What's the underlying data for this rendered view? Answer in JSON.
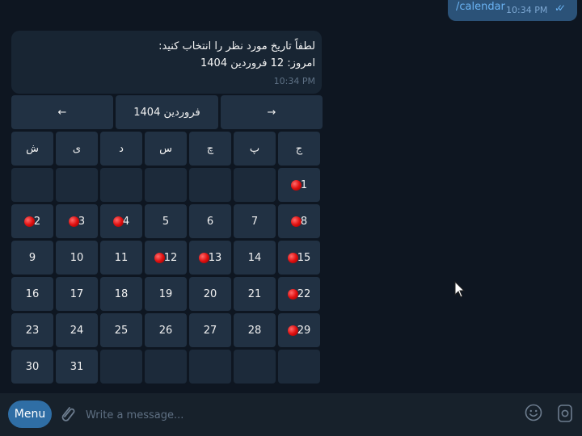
{
  "outgoing": {
    "text": "/calendar",
    "time": "10:34 PM",
    "status_icon": "double-check-icon"
  },
  "incoming": {
    "line1": "لطفاً تاریخ مورد نظر را انتخاب کنید:",
    "line2": "امروز: 12 فروردین 1404",
    "time": "10:34 PM"
  },
  "keyboard": {
    "nav": {
      "prev": "←",
      "month": "فروردین 1404",
      "next": "→"
    },
    "weekdays": [
      "ش",
      "ی",
      "د",
      "س",
      "چ",
      "پ",
      "ج"
    ],
    "weeks": [
      [
        {
          "d": ""
        },
        {
          "d": ""
        },
        {
          "d": ""
        },
        {
          "d": ""
        },
        {
          "d": ""
        },
        {
          "d": ""
        },
        {
          "d": "1",
          "mark": true
        }
      ],
      [
        {
          "d": "2",
          "mark": true
        },
        {
          "d": "3",
          "mark": true
        },
        {
          "d": "4",
          "mark": true
        },
        {
          "d": "5"
        },
        {
          "d": "6"
        },
        {
          "d": "7"
        },
        {
          "d": "8",
          "mark": true
        }
      ],
      [
        {
          "d": "9"
        },
        {
          "d": "10"
        },
        {
          "d": "11"
        },
        {
          "d": "12",
          "mark": true
        },
        {
          "d": "13",
          "mark": true
        },
        {
          "d": "14"
        },
        {
          "d": "15",
          "mark": true
        }
      ],
      [
        {
          "d": "16"
        },
        {
          "d": "17"
        },
        {
          "d": "18"
        },
        {
          "d": "19"
        },
        {
          "d": "20"
        },
        {
          "d": "21"
        },
        {
          "d": "22",
          "mark": true
        }
      ],
      [
        {
          "d": "23"
        },
        {
          "d": "24"
        },
        {
          "d": "25"
        },
        {
          "d": "26"
        },
        {
          "d": "27"
        },
        {
          "d": "28"
        },
        {
          "d": "29",
          "mark": true
        }
      ],
      [
        {
          "d": "30"
        },
        {
          "d": "31"
        },
        {
          "d": ""
        },
        {
          "d": ""
        },
        {
          "d": ""
        },
        {
          "d": ""
        },
        {
          "d": ""
        }
      ]
    ],
    "mark_icon": "red-circle-icon"
  },
  "composer": {
    "menu_label": "Menu",
    "placeholder": "Write a message...",
    "attach_icon": "paperclip-icon",
    "emoji_icon": "smiley-icon",
    "sticker_icon": "sticker-icon"
  },
  "colors": {
    "background": "#0e1621",
    "bubble_in": "#182533",
    "bubble_out": "#2b5278",
    "button": "#213143",
    "accent": "#2f6ea5",
    "mark": "#e01010"
  }
}
